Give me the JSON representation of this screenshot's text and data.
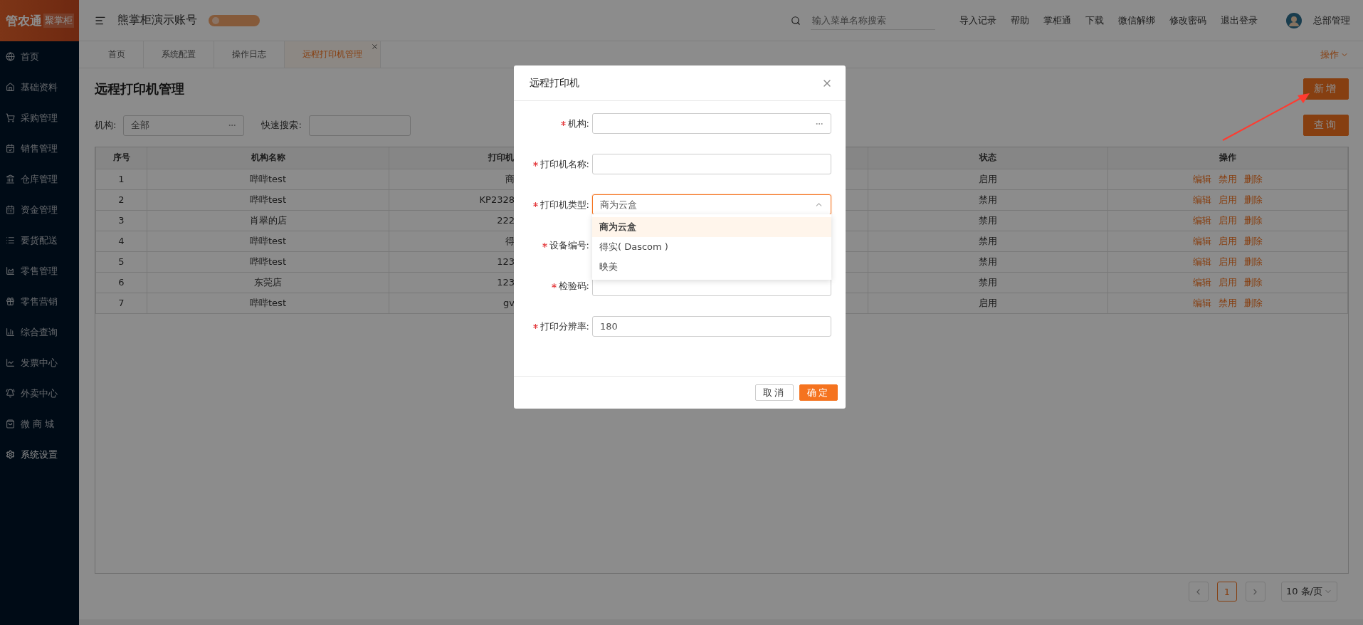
{
  "logo": {
    "text": "管农通",
    "subtext": "聚掌柜"
  },
  "header": {
    "account": "熊掌柜演示账号",
    "search": {
      "placeholder": "输入菜单名称搜索"
    },
    "links": [
      "导入记录",
      "帮助",
      "掌柜通",
      "下载",
      "微信解绑",
      "修改密码",
      "退出登录"
    ],
    "user": "总部管理"
  },
  "sidebar": {
    "items": [
      {
        "label": "首页",
        "selected": false
      },
      {
        "label": "基础资料",
        "selected": false
      },
      {
        "label": "采购管理",
        "selected": false
      },
      {
        "label": "销售管理",
        "selected": false
      },
      {
        "label": "仓库管理",
        "selected": false
      },
      {
        "label": "资金管理",
        "selected": false
      },
      {
        "label": "要货配送",
        "selected": false
      },
      {
        "label": "零售管理",
        "selected": false
      },
      {
        "label": "零售营销",
        "selected": false
      },
      {
        "label": "综合查询",
        "selected": false
      },
      {
        "label": "发票中心",
        "selected": false
      },
      {
        "label": "外卖中心",
        "selected": false
      },
      {
        "label": "微 商 城",
        "selected": false
      },
      {
        "label": "系统设置",
        "selected": true
      }
    ]
  },
  "tabs": [
    {
      "label": "首页",
      "selected": false,
      "closable": false
    },
    {
      "label": "系统配置",
      "selected": false,
      "closable": false
    },
    {
      "label": "操作日志",
      "selected": false,
      "closable": false
    },
    {
      "label": "远程打印机管理",
      "selected": true,
      "closable": true
    }
  ],
  "tab_actions": "操作",
  "page": {
    "title": "远程打印机管理",
    "add_button": "新增",
    "filters": [
      {
        "label": "机构:",
        "value": "全部",
        "kind": "picker"
      },
      {
        "label": "快速搜索:",
        "kind": "text"
      }
    ],
    "query_button": "查询"
  },
  "table": {
    "columns": [
      "序号",
      "机构名称",
      "打印机",
      "状态",
      "操作"
    ],
    "rows": [
      {
        "no": "1",
        "org": "哔哔test",
        "printer": "商",
        "status": "启用",
        "actions": [
          "编辑",
          "禁用",
          "删除"
        ]
      },
      {
        "no": "2",
        "org": "哔哔test",
        "printer": "KP2328",
        "status": "禁用",
        "actions": [
          "编辑",
          "启用",
          "删除"
        ]
      },
      {
        "no": "3",
        "org": "肖翠的店",
        "printer": "222",
        "status": "禁用",
        "actions": [
          "编辑",
          "启用",
          "删除"
        ]
      },
      {
        "no": "4",
        "org": "哔哔test",
        "printer": "得",
        "status": "禁用",
        "actions": [
          "编辑",
          "启用",
          "删除"
        ]
      },
      {
        "no": "5",
        "org": "哔哔test",
        "printer": "123",
        "status": "禁用",
        "actions": [
          "编辑",
          "启用",
          "删除"
        ]
      },
      {
        "no": "6",
        "org": "东莞店",
        "printer": "123",
        "status": "禁用",
        "actions": [
          "编辑",
          "启用",
          "删除"
        ]
      },
      {
        "no": "7",
        "org": "哔哔test",
        "printer": "gv",
        "status": "启用",
        "actions": [
          "编辑",
          "禁用",
          "删除"
        ]
      }
    ]
  },
  "pagination": {
    "pages": [
      {
        "label": "1",
        "selected": true
      }
    ],
    "page_size": "10 条/页"
  },
  "modal": {
    "title": "远程打印机",
    "fields": [
      {
        "label": "机构:",
        "required": true,
        "kind": "picker"
      },
      {
        "label": "打印机名称:",
        "required": true,
        "kind": "text"
      },
      {
        "label": "打印机类型:",
        "required": true,
        "kind": "select",
        "value": "商为云盒",
        "open": true
      },
      {
        "label": "设备编号:",
        "required": true,
        "kind": "text"
      },
      {
        "label": "检验码:",
        "required": true,
        "kind": "text"
      },
      {
        "label": "打印分辨率:",
        "required": true,
        "kind": "text",
        "value": "180"
      }
    ],
    "options": [
      {
        "label": "商为云盒",
        "selected": true
      },
      {
        "label": "得实( Dascom )",
        "selected": false
      },
      {
        "label": "映美",
        "selected": false
      }
    ],
    "buttons": [
      {
        "label": "取消",
        "kind": "default"
      },
      {
        "label": "确定",
        "kind": "primary"
      }
    ]
  }
}
